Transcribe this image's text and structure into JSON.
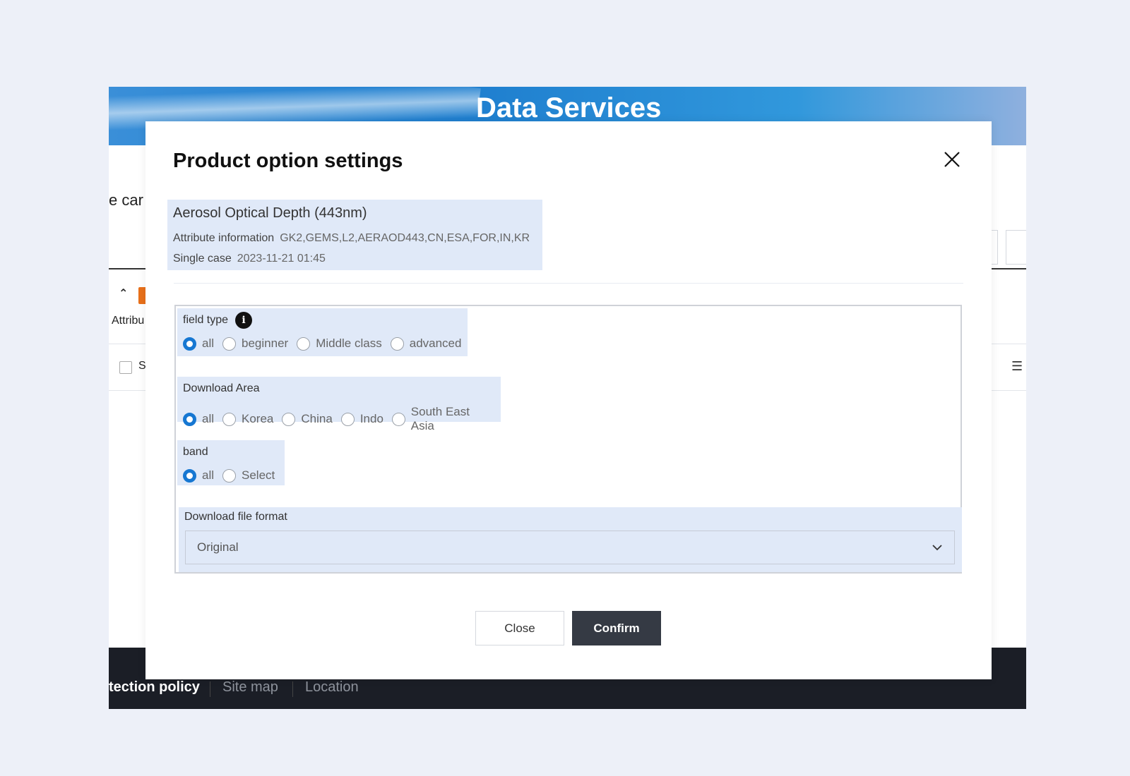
{
  "background_page": {
    "header_title": "Data Services",
    "partial_heading": "e car",
    "partial_attribute_label": "Attribu",
    "partial_checkbox_label": "S",
    "footer_links": [
      "tection policy",
      "Site map",
      "Location"
    ]
  },
  "modal": {
    "title": "Product option settings",
    "product": {
      "name": "Aerosol Optical Depth (443nm)",
      "attribute_label": "Attribute information",
      "attribute_value": "GK2,GEMS,L2,AERAOD443,CN,ESA,FOR,IN,KR",
      "single_case_label": "Single case",
      "single_case_value": "2023-11-21 01:45"
    },
    "field_type": {
      "label": "field type",
      "options": [
        "all",
        "beginner",
        "Middle class",
        "advanced"
      ],
      "selected": "all"
    },
    "download_area": {
      "label": "Download Area",
      "options": [
        "all",
        "Korea",
        "China",
        "Indo",
        "South East Asia"
      ],
      "selected": "all"
    },
    "band": {
      "label": "band",
      "options": [
        "all",
        "Select"
      ],
      "selected": "all"
    },
    "file_format": {
      "label": "Download file format",
      "value": "Original"
    },
    "buttons": {
      "close": "Close",
      "confirm": "Confirm"
    }
  },
  "colors": {
    "accent": "#1677d2",
    "panel_bg": "#e0e9f8",
    "confirm_bg": "#353a44",
    "footer_bg": "#1b1e26"
  }
}
